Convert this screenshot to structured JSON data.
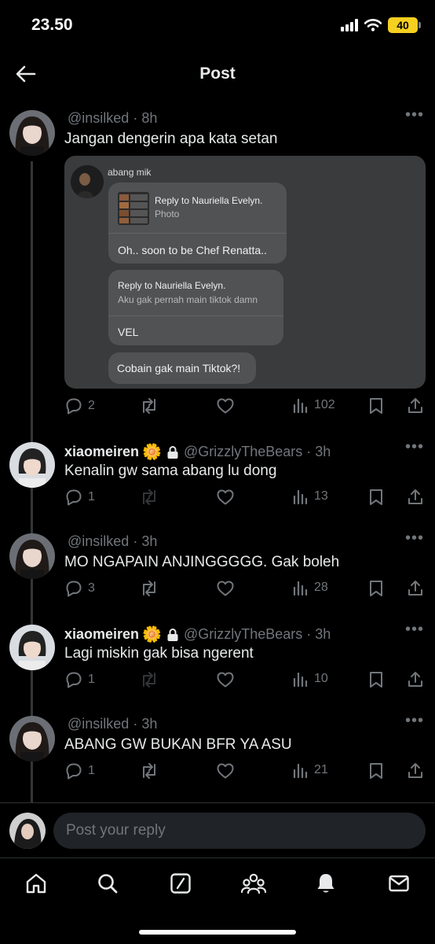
{
  "status_bar": {
    "time": "23.50",
    "battery": "40"
  },
  "header": {
    "title": "Post"
  },
  "posts": [
    {
      "display_name": "",
      "handle": "@insilked",
      "time": "8h",
      "text": "Jangan dengerin apa kata setan",
      "media": {
        "sender": "abang mik",
        "bubble1": {
          "reply_to": "Reply to Nauriella Evelyn.",
          "preview": "Photo",
          "message": "Oh.. soon to be Chef Renatta.."
        },
        "bubble2": {
          "reply_to": "Reply to Nauriella Evelyn.",
          "preview": "Aku gak pernah main tiktok damn",
          "message": "VEL"
        },
        "bubble3": {
          "message": "Cobain gak main Tiktok?!"
        }
      },
      "stats": {
        "replies": "2",
        "reposts": "",
        "views": "102"
      }
    },
    {
      "display_name": "xiaomeiren",
      "handle": "@GrizzlyTheBears",
      "time": "3h",
      "text": "Kenalin gw sama abang lu dong",
      "stats": {
        "replies": "1",
        "reposts": "",
        "views": "13"
      }
    },
    {
      "display_name": "",
      "handle": "@insilked",
      "time": "3h",
      "text": "MO NGAPAIN ANJINGGGGG. Gak boleh",
      "stats": {
        "replies": "3",
        "reposts": "",
        "views": "28"
      }
    },
    {
      "display_name": "xiaomeiren",
      "handle": "@GrizzlyTheBears",
      "time": "3h",
      "text": "Lagi miskin gak bisa ngerent",
      "stats": {
        "replies": "1",
        "reposts": "",
        "views": "10"
      }
    },
    {
      "display_name": "",
      "handle": "@insilked",
      "time": "3h",
      "text": "ABANG GW BUKAN BFR YA ASU",
      "stats": {
        "replies": "1",
        "reposts": "",
        "views": "21"
      }
    }
  ],
  "reply": {
    "placeholder": "Post your reply"
  },
  "colors": {
    "background": "#000000",
    "text": "#e7e9ea",
    "muted": "#71767b",
    "card": "#3a3b3d",
    "bubble": "#515254",
    "battery": "#f5d020"
  },
  "icons": {
    "actions": [
      "reply-icon",
      "repost-icon",
      "like-icon",
      "views-icon",
      "bookmark-icon",
      "share-icon"
    ],
    "tabs": [
      "home-icon",
      "search-icon",
      "grok-icon",
      "communities-icon",
      "notifications-icon",
      "messages-icon"
    ]
  }
}
